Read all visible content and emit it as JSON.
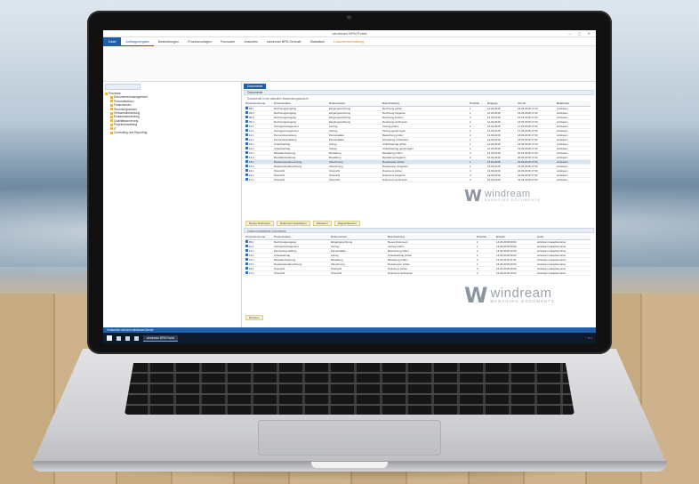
{
  "app": {
    "title": "windream BPM Portal",
    "ribbon_tabs": [
      {
        "label": "Datei",
        "kind": "file"
      },
      {
        "label": "Auftragsvergabe",
        "kind": "active"
      },
      {
        "label": "Bearbeitungen",
        "kind": "normal"
      },
      {
        "label": "Prozessvorlagen",
        "kind": "normal"
      },
      {
        "label": "Formulare",
        "kind": "normal"
      },
      {
        "label": "Ansichten",
        "kind": "normal"
      },
      {
        "label": "windream BPM Zentrale",
        "kind": "normal"
      },
      {
        "label": "Statistiken",
        "kind": "normal"
      },
      {
        "label": "Dokumentverwaltung",
        "kind": "highlight"
      }
    ]
  },
  "tree": {
    "root": "Prozesse",
    "items": [
      "Dokumentenmanagement",
      "Personalwesen",
      "Finanzwesen",
      "Rechnungswesen",
      "Verkaufsabwicklung",
      "Einkaufsabwicklung",
      "Qualitätssicherung",
      "Projektverwaltung",
      "IT",
      "Controlling und Reporting"
    ]
  },
  "main": {
    "doc_tab": "Dokumente",
    "section1": "Dokumente",
    "subtitle1": "Dokumente in der aktuellen Bearbeitungsansicht",
    "columns1": [
      "Prozessnummer",
      "Prozessname",
      "Dokumentart",
      "Beschreibung",
      "Priorität",
      "Eingang",
      "Termin",
      "Bearbeiter"
    ],
    "rows1": [
      [
        "09.1",
        "Rechnungseingang",
        "Eingangsrechnung",
        "Rechnung prüfen",
        "1",
        "12.03.2018",
        "15.03.2018 17:00",
        "windream"
      ],
      [
        "09.2",
        "Rechnungseingang",
        "Eingangsrechnung",
        "Rechnung freigeben",
        "1",
        "12.03.2018",
        "15.03.2018 17:00",
        "windream"
      ],
      [
        "09.3",
        "Rechnungseingang",
        "Eingangsrechnung",
        "Rechnung buchen",
        "2",
        "12.03.2018",
        "16.03.2018 17:00",
        "windream"
      ],
      [
        "09.4",
        "Rechnungseingang",
        "Eingangsrechnung",
        "Rechnung archivieren",
        "2",
        "12.03.2018",
        "16.03.2018 17:00",
        "windream"
      ],
      [
        "11.1",
        "Vertragsmanagement",
        "Vertrag",
        "Vertrag prüfen",
        "1",
        "13.03.2018",
        "17.03.2018 17:00",
        "windream"
      ],
      [
        "11.2",
        "Vertragsmanagement",
        "Vertrag",
        "Vertrag genehmigen",
        "1",
        "13.03.2018",
        "17.03.2018 17:00",
        "windream"
      ],
      [
        "12.1",
        "Personalverwaltung",
        "Personalakte",
        "Bewerbung prüfen",
        "2",
        "13.03.2018",
        "18.03.2018 17:00",
        "windream"
      ],
      [
        "12.2",
        "Personalverwaltung",
        "Personalakte",
        "Einstellung vorbereiten",
        "1",
        "13.03.2018",
        "18.03.2018 17:00",
        "windream"
      ],
      [
        "13.1",
        "Urlaubsantrag",
        "Antrag",
        "Urlaubsantrag prüfen",
        "1",
        "14.03.2018",
        "19.03.2018 17:00",
        "windream"
      ],
      [
        "13.2",
        "Urlaubsantrag",
        "Antrag",
        "Urlaubsantrag genehmigen",
        "1",
        "14.03.2018",
        "19.03.2018 17:00",
        "windream"
      ],
      [
        "14.1",
        "Bestellanforderung",
        "Bestellung",
        "Bestellung prüfen",
        "2",
        "14.03.2018",
        "20.03.2018 17:00",
        "windream"
      ],
      [
        "14.2",
        "Bestellanforderung",
        "Bestellung",
        "Bestellung freigeben",
        "2",
        "15.03.2018",
        "20.03.2018 17:00",
        "windream"
      ],
      [
        "15.1",
        "Reisekostenabrechnung",
        "Abrechnung",
        "Reisekosten prüfen",
        "1",
        "15.03.2018",
        "21.03.2018 17:00",
        "windream"
      ],
      [
        "15.2",
        "Reisekostenabrechnung",
        "Abrechnung",
        "Reisekosten freigeben",
        "1",
        "15.03.2018",
        "21.03.2018 17:00",
        "windream"
      ],
      [
        "16.1",
        "Übersicht",
        "Übersicht",
        "Dokument prüfen",
        "3",
        "16.03.2018",
        "22.03.2018 17:00",
        "windream"
      ],
      [
        "16.2",
        "Übersicht",
        "Übersicht",
        "Dokument freigeben",
        "3",
        "16.03.2018",
        "22.03.2018 17:00",
        "windream"
      ],
      [
        "17.1",
        "Übersicht",
        "Übersicht",
        "Dokument archivieren",
        "3",
        "16.03.2018",
        "23.03.2018 17:00",
        "windream"
      ]
    ],
    "selected_row": 12,
    "toolbar_buttons": [
      "Neues Dokument",
      "Dokument bearbeiten",
      "Ablehnen",
      "Abgeschlossen"
    ],
    "subtitle2": "Zuletzt bearbeitete Dokumente",
    "columns2": [
      "Prozessnummer",
      "Prozessname",
      "Dokumentart",
      "Beschreibung",
      "Priorität",
      "Erstellt",
      "Autor"
    ],
    "rows2": [
      [
        "09.1",
        "Rechnungseingang",
        "Eingangsrechnung",
        "Neues Dokument",
        "1",
        "12.03.2018 09:00",
        "windream Hauptbenutzer"
      ],
      [
        "11.1",
        "Vertragsmanagement",
        "Vertrag",
        "Vertrag prüfen",
        "1",
        "13.03.2018 09:00",
        "windream Hauptbenutzer"
      ],
      [
        "12.1",
        "Personalverwaltung",
        "Personalakte",
        "Bewerbung prüfen",
        "2",
        "13.03.2018 10:00",
        "windream Hauptbenutzer"
      ],
      [
        "13.1",
        "Urlaubsantrag",
        "Antrag",
        "Urlaubsantrag prüfen",
        "1",
        "14.03.2018 09:00",
        "windream Hauptbenutzer"
      ],
      [
        "14.1",
        "Bestellanforderung",
        "Bestellung",
        "Bestellung prüfen",
        "2",
        "14.03.2018 11:00",
        "windream Hauptbenutzer"
      ],
      [
        "15.1",
        "Reisekostenabrechnung",
        "Abrechnung",
        "Reisekosten prüfen",
        "1",
        "15.03.2018 09:00",
        "windream Hauptbenutzer"
      ],
      [
        "16.1",
        "Übersicht",
        "Übersicht",
        "Dokument prüfen",
        "3",
        "16.03.2018 09:00",
        "windream Hauptbenutzer"
      ],
      [
        "17.1",
        "Übersicht",
        "Übersicht",
        "Dokument archivieren",
        "3",
        "16.03.2018 10:00",
        "windream Hauptbenutzer"
      ]
    ],
    "bottom_button": "Drucken"
  },
  "watermark": {
    "name": "windream",
    "tagline": "MANAGING DOCUMENTS"
  },
  "statusbar": "Verbunden mit dem windream Server",
  "taskbar": {
    "app_label": "windream BPM Portal"
  },
  "colors": {
    "accent": "#1f5faa",
    "highlight": "#d08a14",
    "taskbar": "#0c1a2b"
  }
}
